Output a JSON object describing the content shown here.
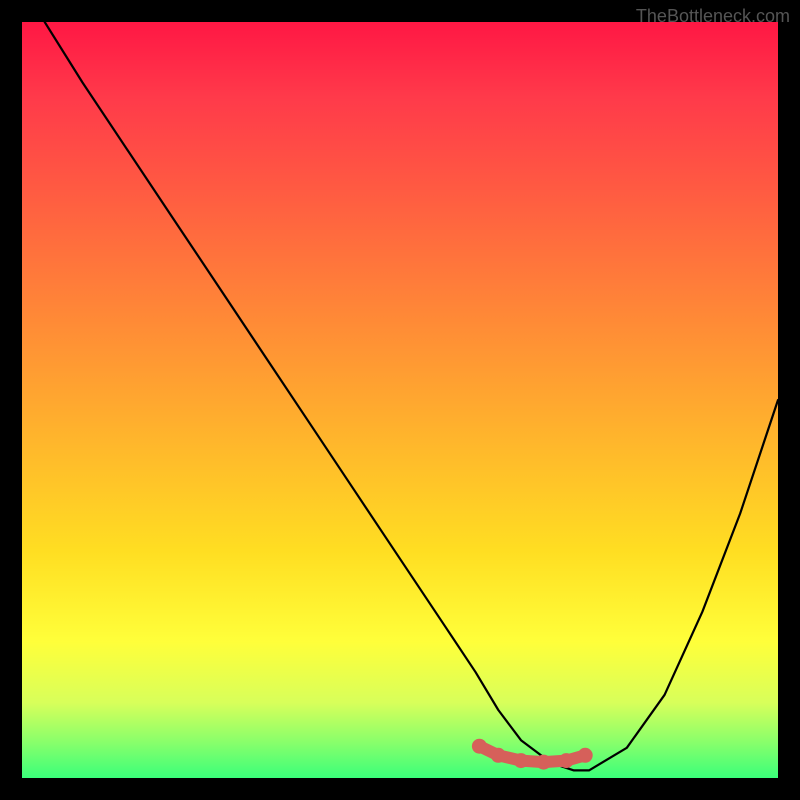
{
  "watermark": "TheBottleneck.com",
  "chart_data": {
    "type": "line",
    "title": "",
    "xlabel": "",
    "ylabel": "",
    "xlim": [
      0,
      100
    ],
    "ylim": [
      0,
      100
    ],
    "series": [
      {
        "name": "bottleneck-curve",
        "x": [
          3,
          8,
          14,
          20,
          26,
          32,
          38,
          44,
          50,
          56,
          60,
          63,
          66,
          70,
          73,
          75,
          80,
          85,
          90,
          95,
          100
        ],
        "values": [
          100,
          92,
          83,
          74,
          65,
          56,
          47,
          38,
          29,
          20,
          14,
          9,
          5,
          2,
          1,
          1,
          4,
          11,
          22,
          35,
          50
        ]
      }
    ],
    "markers": {
      "name": "highlight-range",
      "x": [
        60.5,
        63,
        66,
        69,
        72,
        74.5
      ],
      "values": [
        4.2,
        3.0,
        2.3,
        2.1,
        2.3,
        3.0
      ]
    },
    "gradient_colors": {
      "top": "#ff1744",
      "mid": "#ffde22",
      "bottom": "#3aff7a"
    }
  }
}
